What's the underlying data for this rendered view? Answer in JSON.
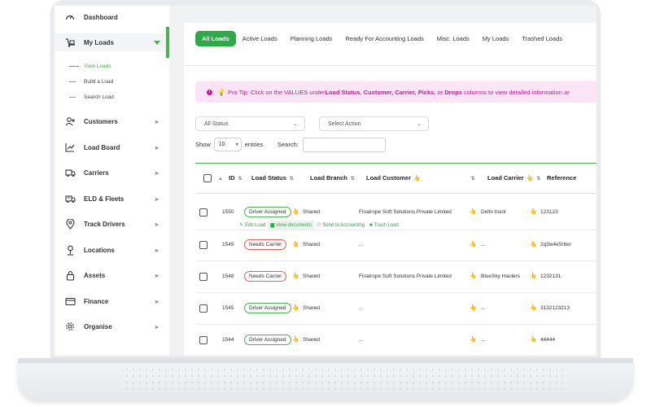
{
  "sidebar": {
    "items": [
      {
        "label": "Dashboard",
        "icon": "speedometer-icon"
      },
      {
        "label": "My Loads",
        "icon": "truck-dolly-icon",
        "active": true
      },
      {
        "label": "Customers",
        "icon": "add-user-icon"
      },
      {
        "label": "Load Board",
        "icon": "chart-line-icon"
      },
      {
        "label": "Carriers",
        "icon": "truck-icon"
      },
      {
        "label": "ELD & Fleets",
        "icon": "fleet-truck-icon"
      },
      {
        "label": "Track Drivers",
        "icon": "map-pin-icon"
      },
      {
        "label": "Locations",
        "icon": "location-marker-icon"
      },
      {
        "label": "Assets",
        "icon": "lock-icon"
      },
      {
        "label": "Finance",
        "icon": "credit-card-icon"
      },
      {
        "label": "Organise",
        "icon": "gear-icon"
      }
    ],
    "subitems": [
      "View Loads",
      "Build a Load",
      "Search Load"
    ]
  },
  "tabs": [
    "All Loads",
    "Active Loads",
    "Planning Loads",
    "Ready For Accounting Loads",
    "Misc. Loads",
    "My Loads",
    "Trashed Loads"
  ],
  "protip": {
    "prefix": "Pro Tip: Click on the VALUES under ",
    "b1": "Load Status",
    "b2": "Customer, Carrier, Picks",
    "mid": ", or ",
    "b3": "Drops",
    "suffix": " columns to view detailed information ar"
  },
  "filters": {
    "status": "All Status",
    "action": "Select Action"
  },
  "show": {
    "label": "Show",
    "value": "10",
    "suffix": "entries",
    "search_label": "Search:"
  },
  "columns": [
    "ID",
    "Load Status",
    "Load Branch",
    "Load Customer",
    "Load Carrier",
    "Reference"
  ],
  "rows": [
    {
      "id": "1550",
      "status": "Driver Assigned",
      "status_type": "assigned",
      "branch": "Shared",
      "customer": "Finalrope Soft Solutions Private Limited",
      "carrier": "Delhi truck",
      "reference": "123123"
    },
    {
      "id": "1549",
      "status": "Needs Carrier",
      "status_type": "needs",
      "branch": "Shared",
      "customer": "...",
      "carrier": "...",
      "reference": "2q3w4e5r6er"
    },
    {
      "id": "1548",
      "status": "Needs Carrier",
      "status_type": "needs",
      "branch": "Shared",
      "customer": "Finalrope Soft Solutions Private Limited",
      "carrier": "BlueSky Haulers",
      "reference": "1232131"
    },
    {
      "id": "1545",
      "status": "Driver Assigned",
      "status_type": "assigned",
      "branch": "Shared",
      "customer": "...",
      "carrier": "...",
      "reference": "3132123213"
    },
    {
      "id": "1544",
      "status": "Driver Assigned",
      "status_type": "assigned",
      "branch": "Shared",
      "customer": "...",
      "carrier": "...",
      "reference": "44444"
    }
  ],
  "row_actions": [
    "Edit Load",
    "View documents",
    "Send to Accounting",
    "Trash Load"
  ],
  "colors": {
    "accent": "#2fa84a",
    "protip_bg": "#fbe4f6",
    "protip_text": "#c21b9a",
    "needs": "#e0605e"
  }
}
